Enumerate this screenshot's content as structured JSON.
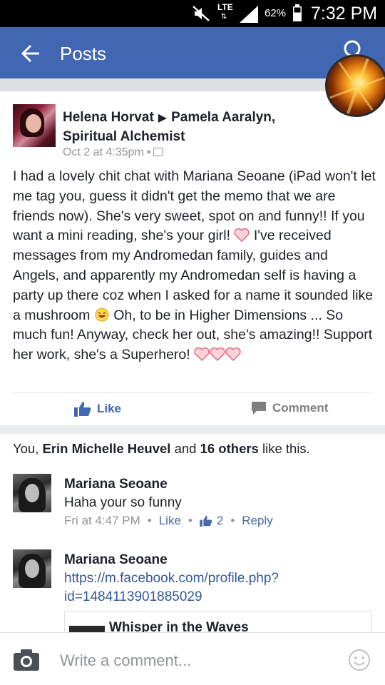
{
  "status_bar": {
    "network": "LTE",
    "battery_percent": "62%",
    "time": "7:32 PM"
  },
  "app_bar": {
    "title": "Posts"
  },
  "post": {
    "author": "Helena Horvat",
    "recipient_line1": "Pamela Aaralyn,",
    "recipient_line2": "Spiritual Alchemist",
    "timestamp": "Oct 2 at 4:35pm",
    "body_part1": "I had a lovely chit chat with Mariana Seoane (iPad won't let me tag you, guess it didn't get the memo that we are friends now). She's very sweet, spot on and funny!! If you want a mini reading, she's your girl!",
    "body_part2": "I've received messages from my Andromedan family, guides and Angels, and apparently my Andromedan self is having a party up there coz when I asked for a name it sounded like a mushroom",
    "body_part3": "Oh, to be in Higher Dimensions ... So much fun! Anyway, check her out, she's amazing!! Support her work, she's a Superhero!",
    "like_label": "Like",
    "comment_label": "Comment",
    "likes_prefix": "You, ",
    "likes_person": "Erin Michelle Heuvel",
    "likes_and": " and ",
    "likes_others": "16 others",
    "likes_suffix": " like this."
  },
  "comments": [
    {
      "author": "Mariana Seoane",
      "text": "Haha your so funny",
      "time": "Fri at 4:47 PM",
      "like_label": "Like",
      "like_count": "2",
      "reply_label": "Reply"
    },
    {
      "author": "Mariana Seoane",
      "link_line1": "https://m.facebook.com/profile.php?",
      "link_line2": "id=1484113901885029",
      "preview_title": "Whisper in the Waves"
    }
  ],
  "composer": {
    "placeholder": "Write a comment..."
  },
  "colors": {
    "brand_blue": "#4267b2",
    "link_blue": "#365899",
    "meta_gray": "#90949c"
  },
  "icons": [
    "mute-icon",
    "signal-icon",
    "battery-icon",
    "back-arrow-icon",
    "search-icon",
    "audience-icon",
    "heart-emoji",
    "laughing-emoji",
    "thumbs-up-icon",
    "comment-icon",
    "camera-icon",
    "emoji-icon"
  ]
}
